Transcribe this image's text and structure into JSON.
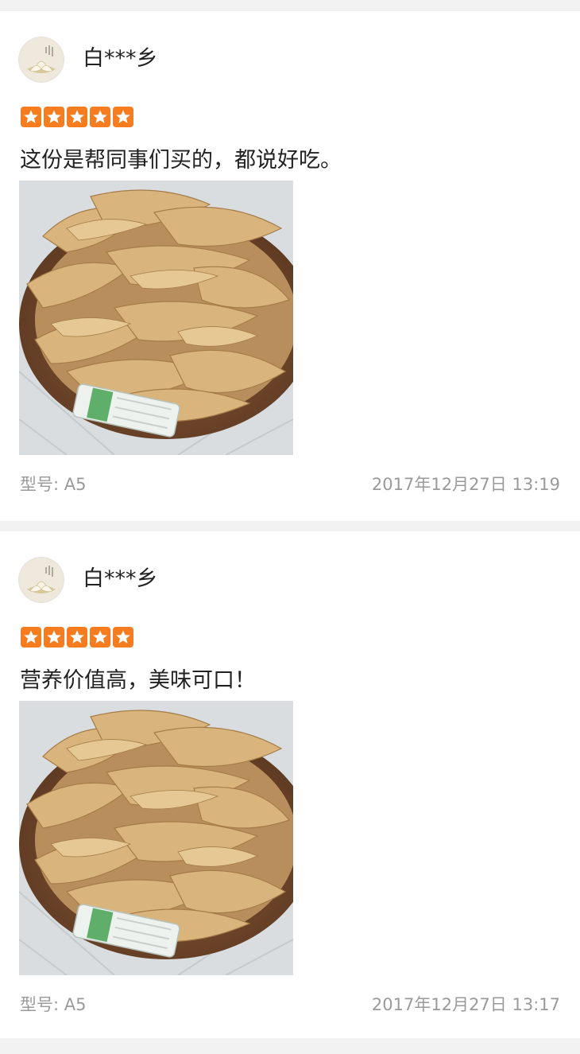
{
  "reviews": [
    {
      "username": "白***乡",
      "rating": 5,
      "comment": "这份是帮同事们买的，都说好吃。",
      "model_label": "型号:",
      "model_value": "A5",
      "time": "2017年12月27日 13:19",
      "photo_icon": "dried-tofu-skin-photo"
    },
    {
      "username": "白***乡",
      "rating": 5,
      "comment": "营养价值高，美味可口！",
      "model_label": "型号:",
      "model_value": "A5",
      "time": "2017年12月27日 13:17",
      "photo_icon": "dried-tofu-skin-photo"
    }
  ],
  "colors": {
    "star": "#f57c1f",
    "meta_text": "#9a9a9a",
    "divider": "#f2f2f2"
  }
}
